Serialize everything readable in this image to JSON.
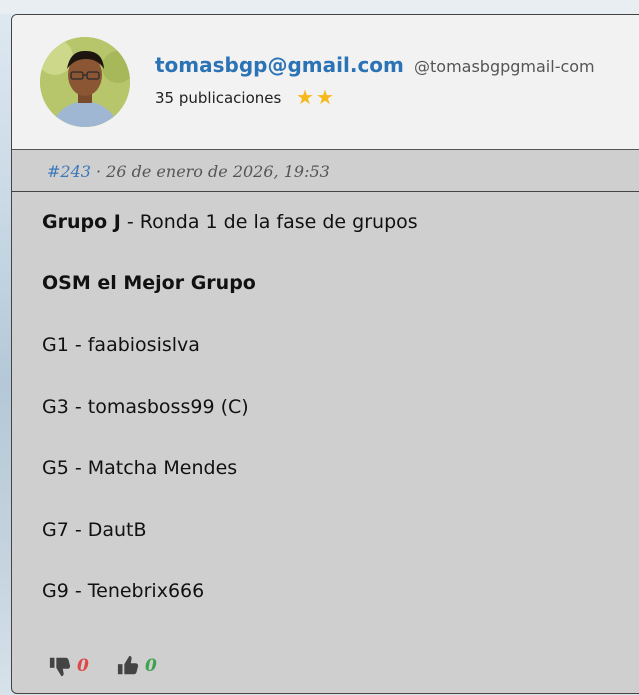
{
  "post": {
    "author": {
      "username": "tomasbgp@gmail.com",
      "handle": "@tomasbgpgmail-com",
      "post_count": "35 publicaciones",
      "stars": 2
    },
    "number": "#243",
    "date": "· 26 de enero de 2026, 19:53",
    "content": {
      "group_label": "Grupo J",
      "group_rest": " - Ronda 1 de la fase de grupos",
      "team_name": "OSM el Mejor Grupo",
      "players": [
        "G1 - faabiosislva",
        "G3 - tomasboss99 (C)",
        "G5 - Matcha Mendes",
        "G7 - DautB",
        "G9 - Tenebrix666"
      ]
    },
    "votes": {
      "dislikes": "0",
      "likes": "0"
    }
  },
  "colors": {
    "username": "#2b73b4",
    "star": "#f6b91c",
    "dislike": "#e04848",
    "like": "#3ea34f"
  }
}
